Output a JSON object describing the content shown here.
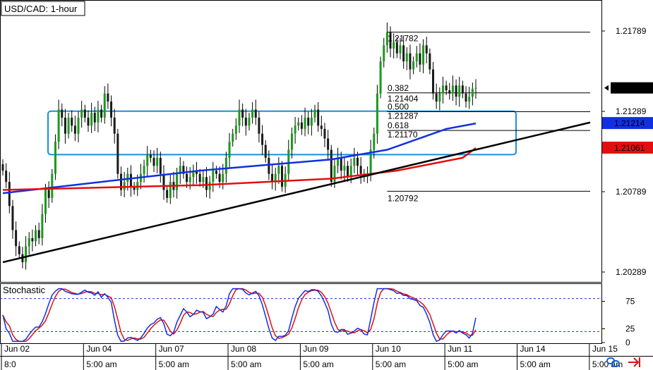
{
  "chart_data": {
    "type": "candlestick",
    "title": "USD/CAD: 1-hour",
    "symbol": "USD/CAD",
    "timeframe": "1-hour",
    "ylim": [
      1.2,
      1.22
    ],
    "price_ticks": [
      "1.21789",
      "1.21289",
      "1.20789",
      "1.20289"
    ],
    "price_tick_values": [
      1.21789,
      1.21289,
      1.20789,
      1.20289
    ],
    "current_price": {
      "label": "1.21435",
      "value": 1.21435,
      "color": "#000000"
    },
    "ma_labels": [
      {
        "label": "1.21214",
        "value": 1.21214,
        "color": "#1030e0"
      },
      {
        "label": "1.21061",
        "value": 1.21061,
        "color": "#e01010"
      }
    ],
    "time_labels": [
      {
        "date": "Jun 02",
        "time": "8:0",
        "t": 0
      },
      {
        "date": "Jun 04",
        "time": "5:00 am",
        "t": 25
      },
      {
        "date": "Jun 07",
        "time": "5:00 am",
        "t": 47
      },
      {
        "date": "Jun 08",
        "time": "5:00 am",
        "t": 69
      },
      {
        "date": "Jun 09",
        "time": "5:00 am",
        "t": 91
      },
      {
        "date": "Jun 10",
        "time": "5:00 am",
        "t": 113
      },
      {
        "date": "Jun 11",
        "time": "5:00 am",
        "t": 135
      },
      {
        "date": "Jun 14",
        "time": "5:00 am",
        "t": 157
      },
      {
        "date": "Jun 15",
        "time": "5:00 am",
        "t": 179
      }
    ],
    "close_series": [
      1.2092,
      1.2085,
      1.207,
      1.2055,
      1.2045,
      1.204,
      1.2035,
      1.2045,
      1.205,
      1.2048,
      1.2055,
      1.205,
      1.2065,
      1.208,
      1.2075,
      1.209,
      1.211,
      1.213,
      1.2125,
      1.2115,
      1.2125,
      1.212,
      1.2115,
      1.2125,
      1.213,
      1.2125,
      1.212,
      1.2128,
      1.2122,
      1.213,
      1.2125,
      1.214,
      1.2135,
      1.2125,
      1.2115,
      1.209,
      1.208,
      1.2085,
      1.209,
      1.2082,
      1.208,
      1.2085,
      1.209,
      1.2095,
      1.2102,
      1.21,
      1.2095,
      1.21,
      1.209,
      1.208,
      1.2075,
      1.2085,
      1.208,
      1.209,
      1.2095,
      1.209,
      1.2085,
      1.2088,
      1.2092,
      1.209,
      1.2085,
      1.2088,
      1.208,
      1.2085,
      1.2092,
      1.209,
      1.2085,
      1.209,
      1.21,
      1.211,
      1.2115,
      1.212,
      1.213,
      1.2125,
      1.212,
      1.2125,
      1.213,
      1.2125,
      1.2115,
      1.2108,
      1.21,
      1.209,
      1.2085,
      1.209,
      1.2095,
      1.2082,
      1.209,
      1.2105,
      1.2115,
      1.212,
      1.2122,
      1.2118,
      1.2125,
      1.212,
      1.2125,
      1.213,
      1.212,
      1.2118,
      1.2112,
      1.2105,
      1.2085,
      1.2095,
      1.21,
      1.2092,
      1.2095,
      1.2088,
      1.2095,
      1.21,
      1.2095,
      1.209,
      1.2088,
      1.209,
      1.2105,
      1.2115,
      1.214,
      1.216,
      1.217,
      1.2178,
      1.2168,
      1.2172,
      1.2165,
      1.217,
      1.216,
      1.2165,
      1.2155,
      1.216,
      1.2165,
      1.2158,
      1.217,
      1.2165,
      1.2155,
      1.214,
      1.2135,
      1.214,
      1.2145,
      1.2142,
      1.214,
      1.2145,
      1.2138,
      1.2145,
      1.214,
      1.2135,
      1.2138,
      1.2143,
      1.21435
    ],
    "sma_blue": {
      "from": 1.2078,
      "via": [
        [
          60,
          1.2092
        ],
        [
          100,
          1.2099
        ],
        [
          117,
          1.2105
        ],
        [
          135,
          1.2118
        ]
      ],
      "to": 1.21214,
      "color": "#1030e0"
    },
    "sma_red": {
      "from": 1.208,
      "via": [
        [
          60,
          1.2083
        ],
        [
          100,
          1.2087
        ],
        [
          120,
          1.2092
        ],
        [
          140,
          1.21
        ]
      ],
      "to": 1.21061,
      "color": "#e01010"
    },
    "trendline": {
      "start": [
        0,
        1.2035
      ],
      "end": [
        178,
        1.2122
      ],
      "color": "#000000"
    },
    "fibonacci": {
      "swing_high": 1.21782,
      "swing_low": 1.20792,
      "levels": [
        {
          "ratio": "",
          "price": "1.21782",
          "value": 1.21782
        },
        {
          "ratio": "0.382",
          "price": "1.21404",
          "value": 1.21404
        },
        {
          "ratio": "0.500",
          "price": "1.21287",
          "value": 1.21287
        },
        {
          "ratio": "0.618",
          "price": "1.21170",
          "value": 1.2117
        },
        {
          "ratio": "",
          "price": "1.20792",
          "value": 1.20792
        }
      ]
    },
    "range_box": {
      "top": 1.2129,
      "bottom": 1.2102,
      "color": "#1a8fd8"
    },
    "stochastic": {
      "title": "Stochastic",
      "ylim": [
        0,
        100
      ],
      "levels": [
        80,
        20
      ],
      "tick_labels": [
        "75",
        "25",
        "0"
      ],
      "tick_values": [
        75,
        25,
        0
      ],
      "k_color": "#1030e0",
      "d_color": "#e01010",
      "level_color": "#1030e0"
    },
    "grid": false,
    "legend": "none"
  }
}
